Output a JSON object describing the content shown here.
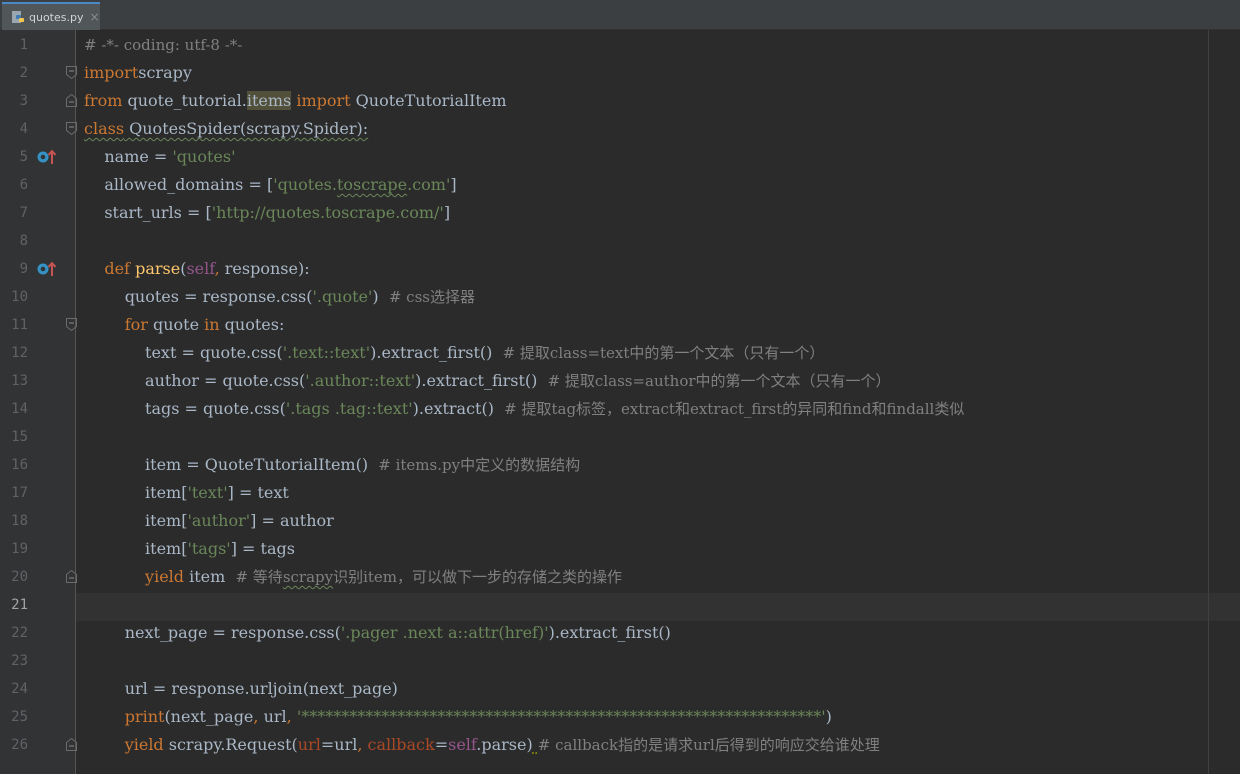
{
  "tab": {
    "filename": "quotes.py"
  },
  "lines": [
    {
      "n": "1",
      "segs": [
        [
          "cmt",
          "# -*- coding: utf-8 -*-"
        ]
      ]
    },
    {
      "n": "2",
      "segs": [
        [
          "kw",
          "import"
        ],
        [
          "",
          "scrapy"
        ]
      ]
    },
    {
      "n": "3",
      "segs": [
        [
          "kw",
          "from"
        ],
        [
          "",
          " quote_tutorial."
        ],
        [
          "hl",
          "items"
        ],
        [
          "",
          " "
        ],
        [
          "kw",
          "import"
        ],
        [
          "",
          " QuoteTutorialItem"
        ]
      ]
    },
    {
      "n": "4",
      "segs": [
        [
          "kwtypo",
          "class"
        ],
        [
          "typo",
          " QuotesSpider(scrapy.Spider):"
        ]
      ]
    },
    {
      "n": "5",
      "segs": [
        [
          "",
          "    name = "
        ],
        [
          "str",
          "'quotes'"
        ]
      ]
    },
    {
      "n": "6",
      "segs": [
        [
          "",
          "    allowed_domains = ["
        ],
        [
          "str",
          "'quotes."
        ],
        [
          "strtypo",
          "toscrape"
        ],
        [
          "str",
          ".com'"
        ],
        [
          "",
          "]"
        ]
      ]
    },
    {
      "n": "7",
      "segs": [
        [
          "",
          "    start_urls = ["
        ],
        [
          "str",
          "'http://quotes.toscrape.com/'"
        ],
        [
          "",
          "]"
        ]
      ]
    },
    {
      "n": "8",
      "segs": []
    },
    {
      "n": "9",
      "segs": [
        [
          "",
          "    "
        ],
        [
          "kw",
          "def"
        ],
        [
          "",
          " "
        ],
        [
          "fn",
          "parse"
        ],
        [
          "",
          "("
        ],
        [
          "slf",
          "self"
        ],
        [
          "kw",
          ","
        ],
        [
          "",
          " response):"
        ]
      ]
    },
    {
      "n": "10",
      "segs": [
        [
          "",
          "        quotes = response.css("
        ],
        [
          "str",
          "'.quote'"
        ],
        [
          "",
          ")  "
        ],
        [
          "cmt",
          "# css选择器"
        ]
      ]
    },
    {
      "n": "11",
      "segs": [
        [
          "",
          "        "
        ],
        [
          "kw",
          "for"
        ],
        [
          "",
          " quote "
        ],
        [
          "kw",
          "in"
        ],
        [
          "",
          " quotes:"
        ]
      ]
    },
    {
      "n": "12",
      "segs": [
        [
          "",
          "            text = quote.css("
        ],
        [
          "str",
          "'.text::text'"
        ],
        [
          "",
          ").extract_first()  "
        ],
        [
          "cmt",
          "# 提取class=text中的第一个文本（只有一个）"
        ]
      ]
    },
    {
      "n": "13",
      "segs": [
        [
          "",
          "            author = quote.css("
        ],
        [
          "str",
          "'.author::text'"
        ],
        [
          "",
          ").extract_first()  "
        ],
        [
          "cmt",
          "# 提取class=author中的第一个文本（只有一个）"
        ]
      ]
    },
    {
      "n": "14",
      "segs": [
        [
          "",
          "            tags = quote.css("
        ],
        [
          "str",
          "'.tags .tag::text'"
        ],
        [
          "",
          ").extract()  "
        ],
        [
          "cmt",
          "# 提取tag标签，extract和extract_first的异同和find和findall类似"
        ]
      ]
    },
    {
      "n": "15",
      "segs": []
    },
    {
      "n": "16",
      "segs": [
        [
          "",
          "            item = QuoteTutorialItem()  "
        ],
        [
          "cmt",
          "# items.py中定义的数据结构"
        ]
      ]
    },
    {
      "n": "17",
      "segs": [
        [
          "",
          "            item["
        ],
        [
          "str",
          "'text'"
        ],
        [
          "",
          "] = text"
        ]
      ]
    },
    {
      "n": "18",
      "segs": [
        [
          "",
          "            item["
        ],
        [
          "str",
          "'author'"
        ],
        [
          "",
          "] = author"
        ]
      ]
    },
    {
      "n": "19",
      "segs": [
        [
          "",
          "            item["
        ],
        [
          "str",
          "'tags'"
        ],
        [
          "",
          "] = tags"
        ]
      ]
    },
    {
      "n": "20",
      "segs": [
        [
          "",
          "            "
        ],
        [
          "kw",
          "yield"
        ],
        [
          "",
          " item  "
        ],
        [
          "cmt",
          "# 等待"
        ],
        [
          "cmttypo",
          "scrapy"
        ],
        [
          "cmt",
          "识别item，可以做下一步的存储之类的操作"
        ]
      ]
    },
    {
      "n": "21",
      "segs": []
    },
    {
      "n": "22",
      "segs": [
        [
          "",
          "        next_page = response.css("
        ],
        [
          "str",
          "'.pager .next a::attr(href)'"
        ],
        [
          "",
          ").extract_first()"
        ]
      ]
    },
    {
      "n": "23",
      "segs": []
    },
    {
      "n": "24",
      "segs": [
        [
          "",
          "        url = response.urljoin(next_page)"
        ]
      ]
    },
    {
      "n": "25",
      "segs": [
        [
          "",
          "        "
        ],
        [
          "kw",
          "print"
        ],
        [
          "",
          "(next_page"
        ],
        [
          "kw",
          ","
        ],
        [
          "",
          " url"
        ],
        [
          "kw",
          ","
        ],
        [
          "",
          " "
        ],
        [
          "str",
          "'*****************************************************************'"
        ],
        [
          "",
          ")"
        ]
      ]
    },
    {
      "n": "26",
      "segs": [
        [
          "",
          "        "
        ],
        [
          "kw",
          "yield"
        ],
        [
          "",
          " scrapy.Request("
        ],
        [
          "kwarg",
          "url"
        ],
        [
          "",
          "=url"
        ],
        [
          "kw",
          ","
        ],
        [
          "",
          " "
        ],
        [
          "kwarg",
          "callback"
        ],
        [
          "",
          "="
        ],
        [
          "slf",
          "self"
        ],
        [
          "",
          ".parse)"
        ],
        [
          "dot",
          " "
        ],
        [
          "cmt",
          "# callback指的是请求url后得到的响应交给谁处理"
        ]
      ]
    }
  ],
  "active_line": "21",
  "colors": {
    "keyword": "#cc7832",
    "string": "#6a8759",
    "comment": "#808080",
    "function": "#ffc66d",
    "self": "#94558d"
  },
  "icons": {
    "tab": "python-file-icon",
    "line5": "override-method-icon",
    "line9": "override-method-icon",
    "fold": "fold-marker-icon"
  }
}
